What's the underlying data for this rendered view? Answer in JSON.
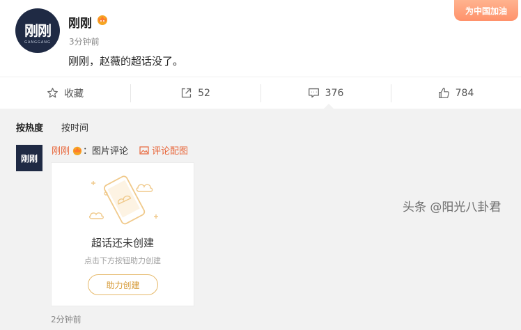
{
  "post": {
    "avatar_text": "刚刚",
    "avatar_sub": "GANGGANG",
    "author": "刚刚",
    "time": "3分钟前",
    "content": "刚刚，赵薇的超话没了。",
    "badge": "为中国加油"
  },
  "actions": {
    "favorite": "收藏",
    "forward_count": "52",
    "comment_count": "376",
    "like_count": "784"
  },
  "comments": {
    "sort_hot": "按热度",
    "sort_time": "按时间",
    "item": {
      "avatar_text": "刚刚",
      "author": "刚刚",
      "colon": "：",
      "text": "图片评论",
      "pic_link": "评论配图",
      "card_title": "超话还未创建",
      "card_sub": "点击下方按钮助力创建",
      "card_button": "助力创建",
      "time": "2分钟前"
    }
  },
  "watermark": "头条 @阳光八卦君",
  "colors": {
    "accent": "#e8673b",
    "button_gold": "#d69a36",
    "avatar_bg": "#1f2a44"
  }
}
